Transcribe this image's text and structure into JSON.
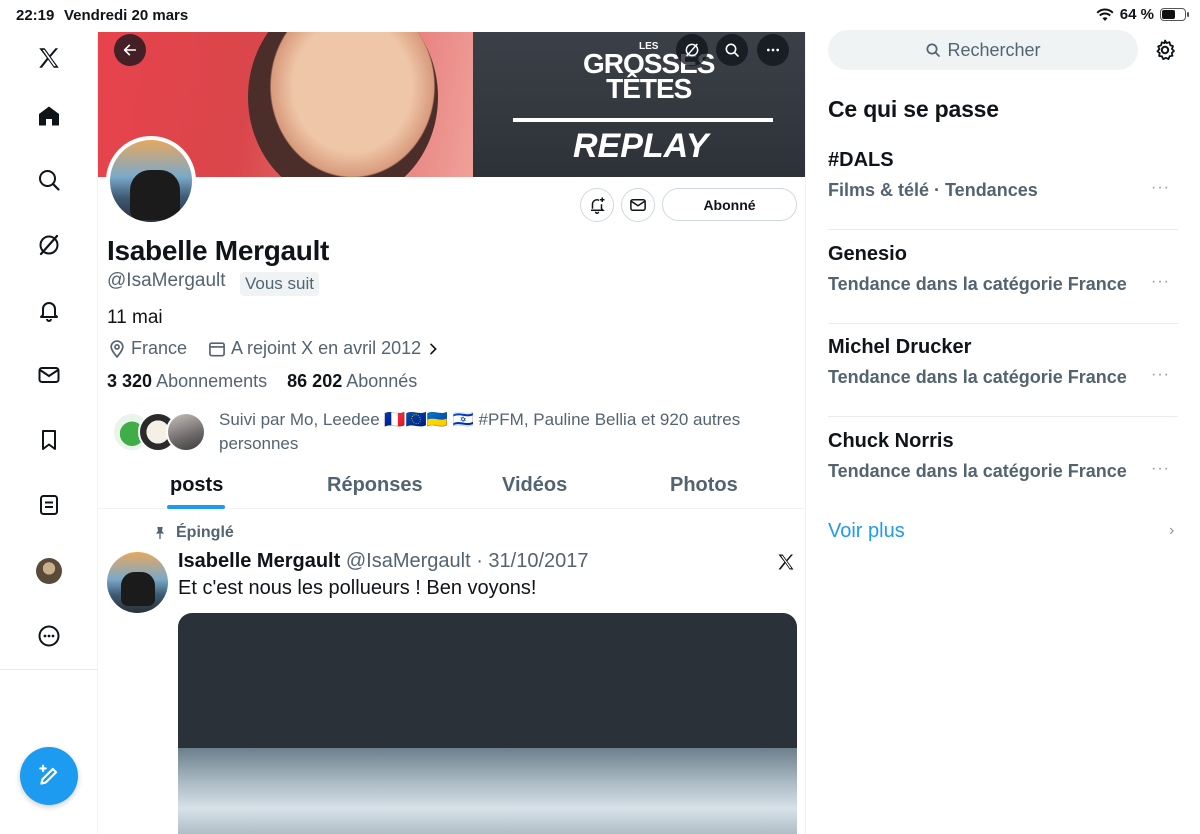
{
  "status": {
    "time": "22:19",
    "date": "Vendredi 20 mars",
    "battery": "64 %",
    "battery_level": 0.64
  },
  "nav": {
    "items": [
      "x-logo-icon",
      "home-icon",
      "explore-icon",
      "grok-icon",
      "notifications-icon",
      "messages-icon",
      "bookmarks-icon",
      "lists-icon",
      "profile-avatar",
      "more-icon"
    ],
    "compose": "compose-icon"
  },
  "banner": {
    "brand_small": "LES",
    "brand_line1": "GROSSES",
    "brand_line2": "TÊTES",
    "replay": "REPLAY",
    "colors": {
      "left": "#e8434c",
      "right": "#2e3238"
    }
  },
  "profile": {
    "name": "Isabelle Mergault",
    "handle": "@IsaMergault",
    "follows_you": "Vous suit",
    "bio": "11 mai",
    "location": "France",
    "joined": "A rejoint X en avril 2012",
    "following_count": "3 320",
    "following_label": "Abonnements",
    "followers_count": "86 202",
    "followers_label": "Abonnés",
    "followed_by": "Suivi par Mo, Leedee 🇫🇷🇪🇺🇺🇦 🇮🇱 #PFM, Pauline Bellia et 920 autres personnes",
    "follow_button": "Abonné"
  },
  "tabs": [
    {
      "label": "posts",
      "active": true
    },
    {
      "label": "Réponses",
      "active": false
    },
    {
      "label": "Vidéos",
      "active": false
    },
    {
      "label": "Photos",
      "active": false
    }
  ],
  "post": {
    "pinned_label": "Épinglé",
    "author": "Isabelle Mergault",
    "meta": "@IsaMergault · 31/10/2017",
    "text": "Et c'est nous les pollueurs ! Ben voyons!"
  },
  "sidebar": {
    "search_placeholder": "Rechercher",
    "title": "Ce qui se passe",
    "trends": [
      {
        "title": "#DALS",
        "context": "Films & télé · Tendances"
      },
      {
        "title": "Genesio",
        "context": "Tendance dans la catégorie France"
      },
      {
        "title": "Michel Drucker",
        "context": "Tendance dans la catégorie France"
      },
      {
        "title": "Chuck Norris",
        "context": "Tendance dans la catégorie France"
      }
    ],
    "see_more": "Voir plus",
    "more_glyph": "···"
  },
  "colors": {
    "accent": "#1d9bf0",
    "text": "#0f1419",
    "muted": "#536471"
  }
}
